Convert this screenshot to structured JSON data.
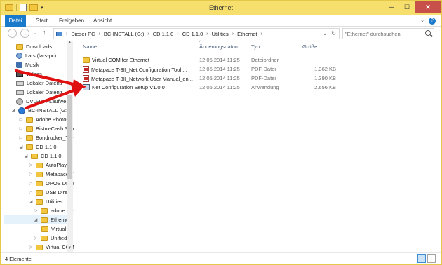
{
  "window": {
    "title": "Ethernet"
  },
  "ribbon": {
    "tabs": [
      "Datei",
      "Start",
      "Freigeben",
      "Ansicht"
    ]
  },
  "address": {
    "crumbs": [
      "Dieser PC",
      "BC-INSTALL (G:)",
      "CD 1.1.0",
      "CD 1.1.0",
      "Utilities",
      "Ethernet"
    ]
  },
  "search": {
    "placeholder": "\"Ethernet\" durchsuchen"
  },
  "nav": {
    "items": [
      {
        "label": "Downloads",
        "icon": "folder-icon"
      },
      {
        "label": "Lars (lars-pc)",
        "icon": "user-icon"
      },
      {
        "label": "Musik",
        "icon": "music-icon"
      },
      {
        "label": "Videos",
        "icon": "video-icon"
      },
      {
        "label": "Lokaler Datentr",
        "icon": "drive-icon"
      },
      {
        "label": "Lokaler Datentr",
        "icon": "drive-icon"
      },
      {
        "label": "DVD-RW-Laufwe",
        "icon": "disc-icon"
      },
      {
        "label": "BC-INSTALL (G:)",
        "icon": "bc-drive-icon"
      },
      {
        "label": "Adobe Photosh",
        "icon": "folder-icon"
      },
      {
        "label": "Bistro-Cash Sch",
        "icon": "folder-icon"
      },
      {
        "label": "Bondrucker_Tre",
        "icon": "folder-icon"
      },
      {
        "label": "CD 1.1.0",
        "icon": "folder-icon"
      },
      {
        "label": "CD 1.1.0",
        "icon": "folder-icon"
      },
      {
        "label": "AutoPlay",
        "icon": "folder-icon"
      },
      {
        "label": "Metapace T",
        "icon": "folder-icon"
      },
      {
        "label": "OPOS Drive",
        "icon": "folder-icon"
      },
      {
        "label": "USB Direct",
        "icon": "folder-icon"
      },
      {
        "label": "Utilities",
        "icon": "folder-icon"
      },
      {
        "label": "adobe Re",
        "icon": "folder-icon"
      },
      {
        "label": "Ethernet",
        "icon": "folder-icon"
      },
      {
        "label": "Virtual C",
        "icon": "folder-icon"
      },
      {
        "label": "Unified P",
        "icon": "folder-icon"
      },
      {
        "label": "Virtual COM",
        "icon": "folder-icon"
      }
    ]
  },
  "columns": {
    "name": "Name",
    "date": "Änderungsdatum",
    "type": "Typ",
    "size": "Größe"
  },
  "files": [
    {
      "name": "Virtual COM for Ethernet",
      "date": "12.05.2014 11:25",
      "type": "Dateiordner",
      "size": "",
      "icon": "folder-icon"
    },
    {
      "name": "Metapace T-3II_Net Configuration Tool ...",
      "date": "12.05.2014 11:25",
      "type": "PDF-Datei",
      "size": "1.362 KB",
      "icon": "pdf-icon"
    },
    {
      "name": "Metapace T-3II_Network User Manual_en...",
      "date": "12.05.2014 11:25",
      "type": "PDF-Datei",
      "size": "1.390 KB",
      "icon": "pdf-icon"
    },
    {
      "name": "Net Configuration Setup V1.0.0",
      "date": "12.05.2014 11:25",
      "type": "Anwendung",
      "size": "2.656 KB",
      "icon": "app-icon"
    }
  ],
  "status": {
    "count": "4 Elemente"
  },
  "colors": {
    "titlebar": "#f7df6e",
    "accent": "#1979ca",
    "arrow": "#e01010",
    "close": "#c7504a"
  }
}
